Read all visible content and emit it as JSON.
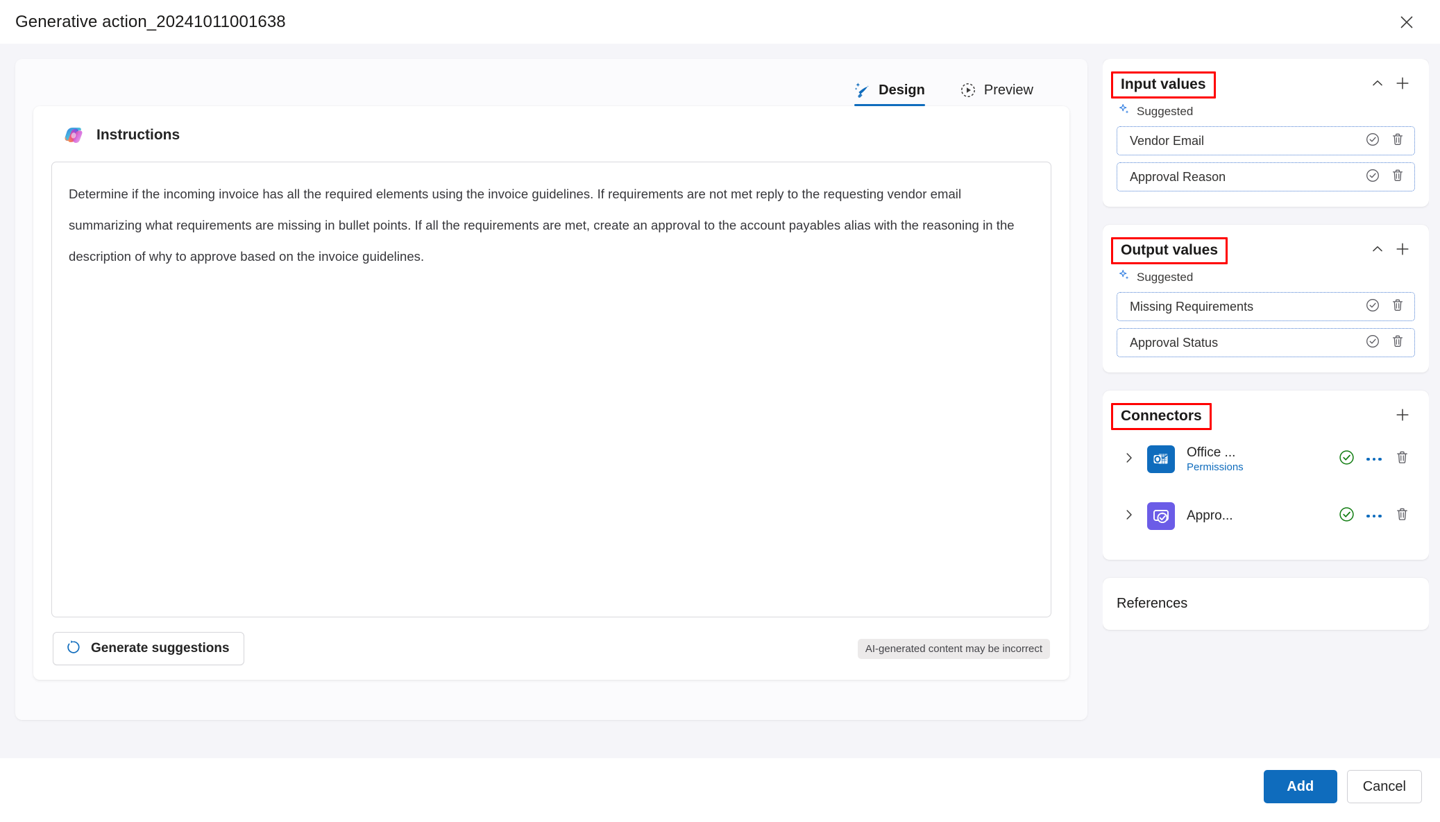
{
  "window": {
    "title": "Generative action_20241011001638",
    "close_icon": "close-icon"
  },
  "tabs": [
    {
      "label": "Design",
      "icon": "sparkle-wand-icon",
      "active": true
    },
    {
      "label": "Preview",
      "icon": "play-circle-dashed-icon",
      "active": false
    }
  ],
  "instructions": {
    "heading": "Instructions",
    "logo_icon": "copilot-icon",
    "text": "Determine if the incoming invoice has all the required elements using the invoice guidelines. If requirements are not met reply to the requesting vendor email summarizing what requirements are missing in bullet points. If all the requirements are met, create an approval to the account payables alias with the reasoning in the description of why to approve based on the invoice guidelines.",
    "generate_button": "Generate suggestions",
    "generate_icon": "refresh-icon",
    "ai_note": "AI-generated content may be incorrect"
  },
  "input_values": {
    "title": "Input values",
    "collapse_icon": "chevron-up-icon",
    "add_icon": "plus-icon",
    "suggested_label": "Suggested",
    "suggested_icon": "sparkle-icon",
    "items": [
      {
        "label": "Vendor Email",
        "accept_icon": "check-circle-icon",
        "delete_icon": "trash-icon"
      },
      {
        "label": "Approval Reason",
        "accept_icon": "check-circle-icon",
        "delete_icon": "trash-icon"
      }
    ]
  },
  "output_values": {
    "title": "Output values",
    "collapse_icon": "chevron-up-icon",
    "add_icon": "plus-icon",
    "suggested_label": "Suggested",
    "suggested_icon": "sparkle-icon",
    "items": [
      {
        "label": "Missing Requirements",
        "accept_icon": "check-circle-icon",
        "delete_icon": "trash-icon"
      },
      {
        "label": "Approval Status",
        "accept_icon": "check-circle-icon",
        "delete_icon": "trash-icon"
      }
    ]
  },
  "connectors": {
    "title": "Connectors",
    "add_icon": "plus-icon",
    "items": [
      {
        "name": "Office ...",
        "sub": "Permissions",
        "icon": "outlook-icon",
        "icon_color": "#0f6cbd",
        "expand_icon": "chevron-right-icon",
        "status_icon": "check-circle-green-icon",
        "more_icon": "ellipsis-icon",
        "delete_icon": "trash-icon"
      },
      {
        "name": "Appro...",
        "sub": "",
        "icon": "approvals-icon",
        "icon_color": "#6b5ce7",
        "expand_icon": "chevron-right-icon",
        "status_icon": "check-circle-green-icon",
        "more_icon": "ellipsis-icon",
        "delete_icon": "trash-icon"
      }
    ]
  },
  "references": {
    "title": "References"
  },
  "footer": {
    "primary": "Add",
    "secondary": "Cancel"
  },
  "colors": {
    "accent": "#0f6cbd",
    "highlight": "#ff0000",
    "success": "#107c10",
    "page_bg": "#f5f5f9",
    "suggested_border": "#4a7fd4"
  }
}
